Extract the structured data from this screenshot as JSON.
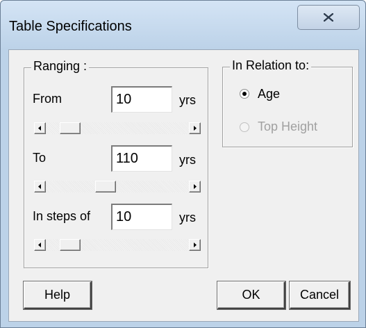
{
  "window": {
    "title": "Table Specifications"
  },
  "ranging": {
    "legend": "Ranging :",
    "from": {
      "label": "From",
      "value": "10",
      "unit": "yrs",
      "slider_fraction": 0.0
    },
    "to": {
      "label": "To",
      "value": "110",
      "unit": "yrs",
      "slider_fraction": 0.33
    },
    "steps": {
      "label": "In steps of",
      "value": "10",
      "unit": "yrs",
      "slider_fraction": 0.0
    }
  },
  "relation": {
    "legend": "In Relation to:",
    "options": [
      {
        "label": "Age",
        "selected": true,
        "enabled": true
      },
      {
        "label": "Top Height",
        "selected": false,
        "enabled": false
      }
    ]
  },
  "buttons": {
    "help": "Help",
    "ok": "OK",
    "cancel": "Cancel"
  },
  "icons": {
    "close": "close-icon",
    "scroll_left": "arrow-left-icon",
    "scroll_right": "arrow-right-icon"
  },
  "colors": {
    "title_bar": "#bcd2e8",
    "dialog_face": "#f0f0f0",
    "disabled_text": "#a0a0a0"
  }
}
